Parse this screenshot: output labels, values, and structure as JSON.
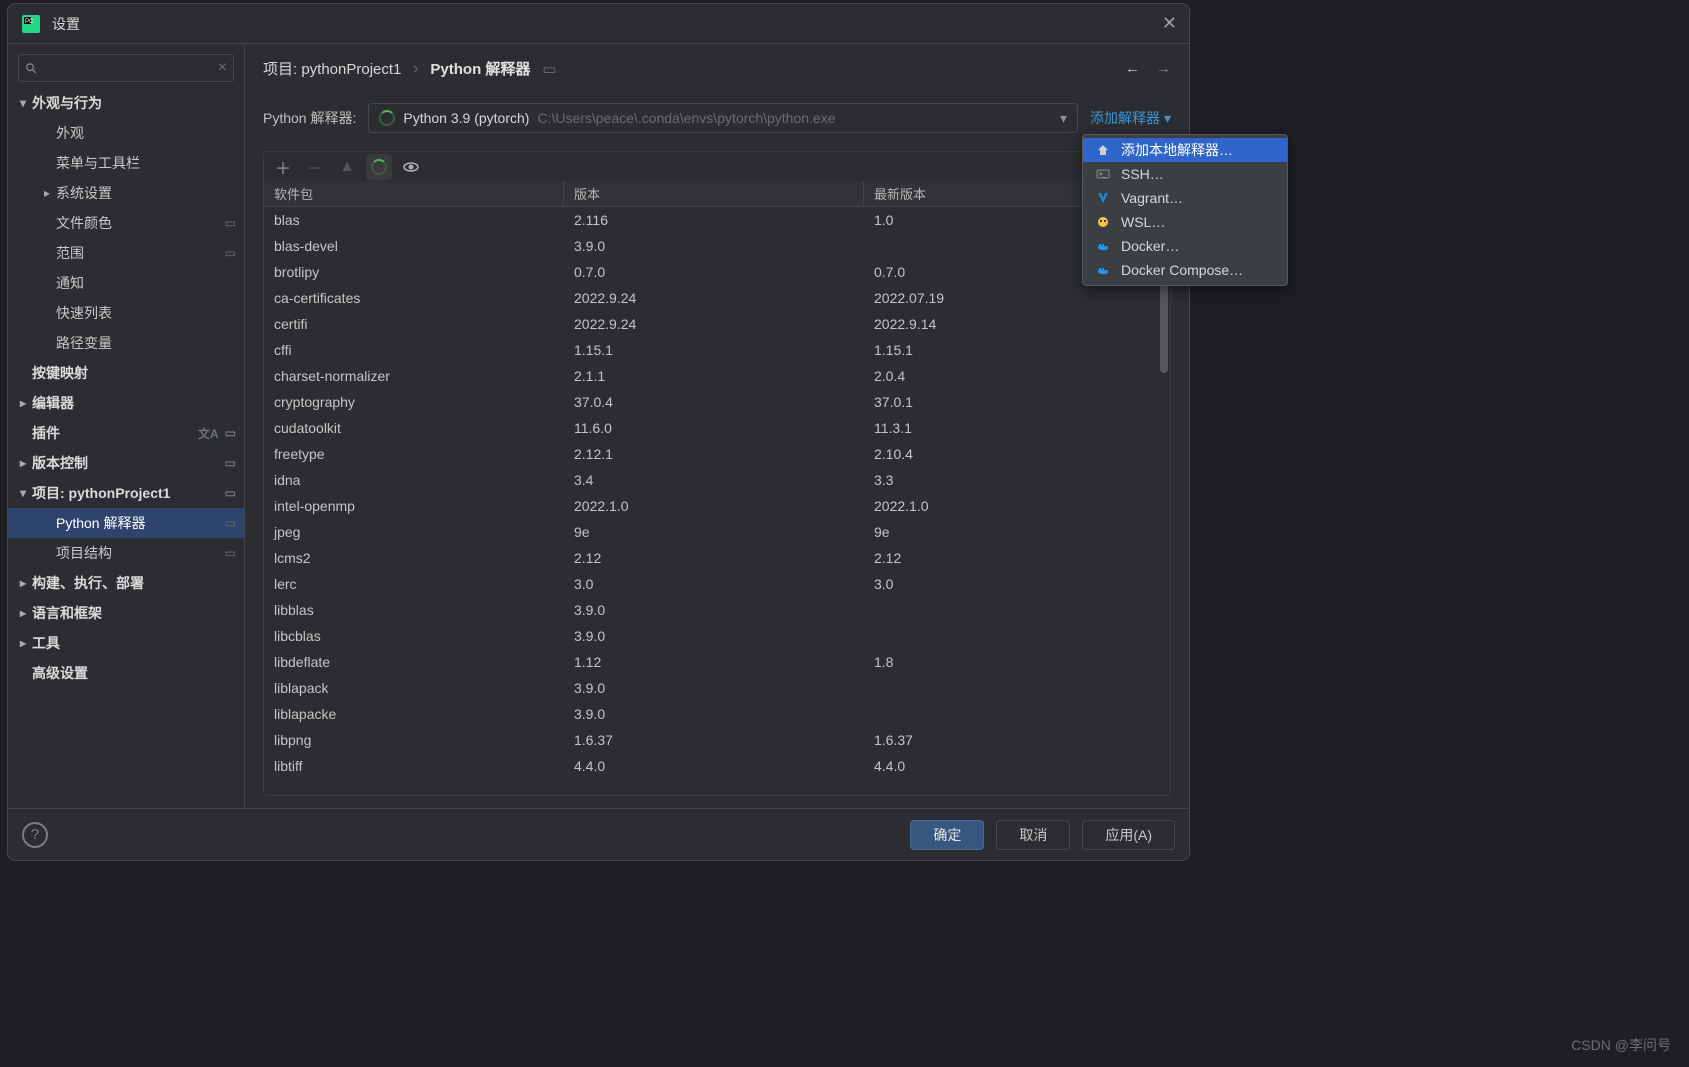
{
  "window": {
    "title": "设置"
  },
  "search": {
    "placeholder": ""
  },
  "sidebar": [
    {
      "label": "外观与行为",
      "bold": true,
      "indent": 0,
      "arrow": "down"
    },
    {
      "label": "外观",
      "indent": 1
    },
    {
      "label": "菜单与工具栏",
      "indent": 1
    },
    {
      "label": "系统设置",
      "indent": 1,
      "arrow": "right"
    },
    {
      "label": "文件颜色",
      "indent": 1,
      "bookmark": true
    },
    {
      "label": "范围",
      "indent": 1,
      "bookmark": true
    },
    {
      "label": "通知",
      "indent": 1
    },
    {
      "label": "快速列表",
      "indent": 1
    },
    {
      "label": "路径变量",
      "indent": 1
    },
    {
      "label": "按键映射",
      "bold": true,
      "indent": 0
    },
    {
      "label": "编辑器",
      "bold": true,
      "indent": 0,
      "arrow": "right"
    },
    {
      "label": "插件",
      "bold": true,
      "indent": 0,
      "gear": true,
      "bookmark": true
    },
    {
      "label": "版本控制",
      "bold": true,
      "indent": 0,
      "arrow": "right",
      "bookmark": true
    },
    {
      "label": "项目: pythonProject1",
      "bold": true,
      "indent": 0,
      "arrow": "down",
      "bookmark": true
    },
    {
      "label": "Python 解释器",
      "indent": 1,
      "bookmark": true,
      "selected": true
    },
    {
      "label": "项目结构",
      "indent": 1,
      "bookmark": true
    },
    {
      "label": "构建、执行、部署",
      "bold": true,
      "indent": 0,
      "arrow": "right"
    },
    {
      "label": "语言和框架",
      "bold": true,
      "indent": 0,
      "arrow": "right"
    },
    {
      "label": "工具",
      "bold": true,
      "indent": 0,
      "arrow": "right"
    },
    {
      "label": "高级设置",
      "bold": true,
      "indent": 0
    }
  ],
  "breadcrumb": {
    "project": "项目: pythonProject1",
    "page": "Python 解释器"
  },
  "interpreter": {
    "label": "Python 解释器:",
    "name": "Python 3.9 (pytorch)",
    "path": "C:\\Users\\peace\\.conda\\envs\\pytorch\\python.exe",
    "add_link": "添加解释器"
  },
  "table": {
    "headers": {
      "pkg": "软件包",
      "ver": "版本",
      "latest": "最新版本"
    },
    "rows": [
      {
        "pkg": "blas",
        "ver": "2.116",
        "latest": "1.0"
      },
      {
        "pkg": "blas-devel",
        "ver": "3.9.0",
        "latest": ""
      },
      {
        "pkg": "brotlipy",
        "ver": "0.7.0",
        "latest": "0.7.0"
      },
      {
        "pkg": "ca-certificates",
        "ver": "2022.9.24",
        "latest": "2022.07.19"
      },
      {
        "pkg": "certifi",
        "ver": "2022.9.24",
        "latest": "2022.9.14"
      },
      {
        "pkg": "cffi",
        "ver": "1.15.1",
        "latest": "1.15.1"
      },
      {
        "pkg": "charset-normalizer",
        "ver": "2.1.1",
        "latest": "2.0.4"
      },
      {
        "pkg": "cryptography",
        "ver": "37.0.4",
        "latest": "37.0.1"
      },
      {
        "pkg": "cudatoolkit",
        "ver": "11.6.0",
        "latest": "11.3.1"
      },
      {
        "pkg": "freetype",
        "ver": "2.12.1",
        "latest": "2.10.4"
      },
      {
        "pkg": "idna",
        "ver": "3.4",
        "latest": "3.3"
      },
      {
        "pkg": "intel-openmp",
        "ver": "2022.1.0",
        "latest": "2022.1.0"
      },
      {
        "pkg": "jpeg",
        "ver": "9e",
        "latest": "9e"
      },
      {
        "pkg": "lcms2",
        "ver": "2.12",
        "latest": "2.12"
      },
      {
        "pkg": "lerc",
        "ver": "3.0",
        "latest": "3.0"
      },
      {
        "pkg": "libblas",
        "ver": "3.9.0",
        "latest": ""
      },
      {
        "pkg": "libcblas",
        "ver": "3.9.0",
        "latest": ""
      },
      {
        "pkg": "libdeflate",
        "ver": "1.12",
        "latest": "1.8"
      },
      {
        "pkg": "liblapack",
        "ver": "3.9.0",
        "latest": ""
      },
      {
        "pkg": "liblapacke",
        "ver": "3.9.0",
        "latest": ""
      },
      {
        "pkg": "libpng",
        "ver": "1.6.37",
        "latest": "1.6.37"
      },
      {
        "pkg": "libtiff",
        "ver": "4.4.0",
        "latest": "4.4.0"
      }
    ]
  },
  "menu": [
    {
      "label": "添加本地解释器…",
      "icon": "home",
      "selected": true
    },
    {
      "label": "SSH…",
      "icon": "ssh"
    },
    {
      "label": "Vagrant…",
      "icon": "vagrant"
    },
    {
      "label": "WSL…",
      "icon": "wsl"
    },
    {
      "label": "Docker…",
      "icon": "docker"
    },
    {
      "label": "Docker Compose…",
      "icon": "docker"
    }
  ],
  "footer": {
    "ok": "确定",
    "cancel": "取消",
    "apply": "应用(A)"
  },
  "watermark": "CSDN @李问号"
}
